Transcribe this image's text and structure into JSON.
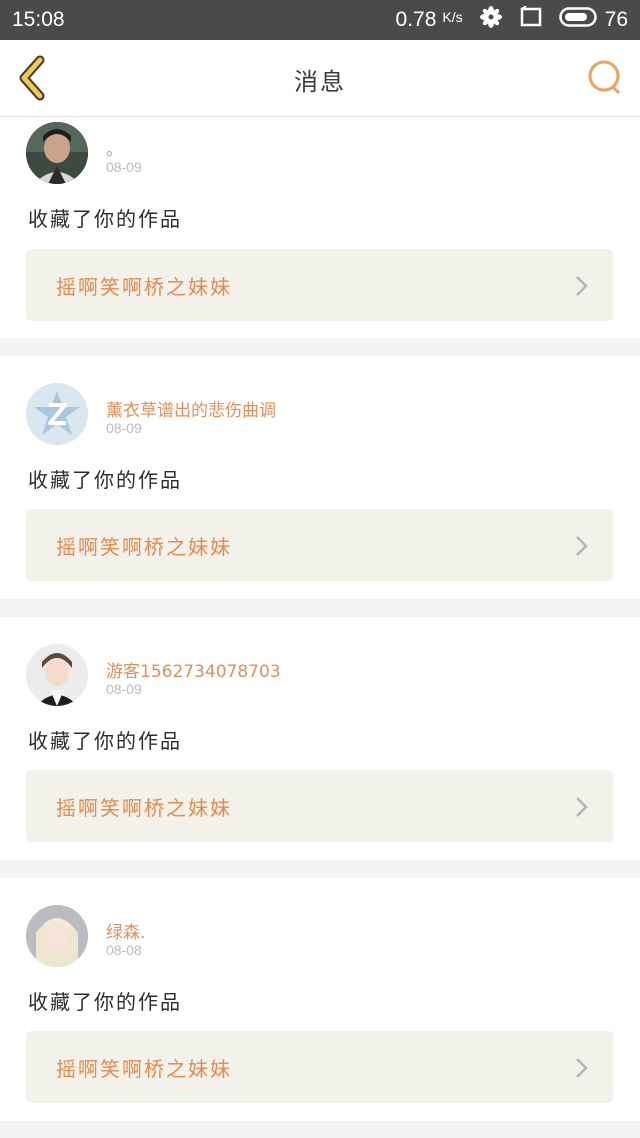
{
  "status_bar": {
    "time": "15:08",
    "net_speed": "0.78",
    "net_unit": "K/s",
    "battery": "76",
    "icons": [
      "flower-icon",
      "screen-icon",
      "battery-icon"
    ]
  },
  "nav": {
    "title": "消息",
    "back_icon": "chevron-left-icon",
    "search_icon": "search-icon"
  },
  "messages": [
    {
      "username": "。",
      "date": "08-09",
      "action": "收藏了你的作品",
      "work_title": "摇啊笑啊桥之妹妹"
    },
    {
      "username": "薰衣草谱出的悲伤曲调",
      "date": "08-09",
      "action": "收藏了你的作品",
      "work_title": "摇啊笑啊桥之妹妹"
    },
    {
      "username": "游客1562734078703",
      "date": "08-09",
      "action": "收藏了你的作品",
      "work_title": "摇啊笑啊桥之妹妹"
    },
    {
      "username": "绿森.",
      "date": "08-08",
      "action": "收藏了你的作品",
      "work_title": "摇啊笑啊桥之妹妹"
    }
  ],
  "colors": {
    "accent": "#e8894f",
    "back_arrow": "#f2c94c",
    "status_bar": "#4a4a4a",
    "work_box": "#f2f2eb"
  }
}
